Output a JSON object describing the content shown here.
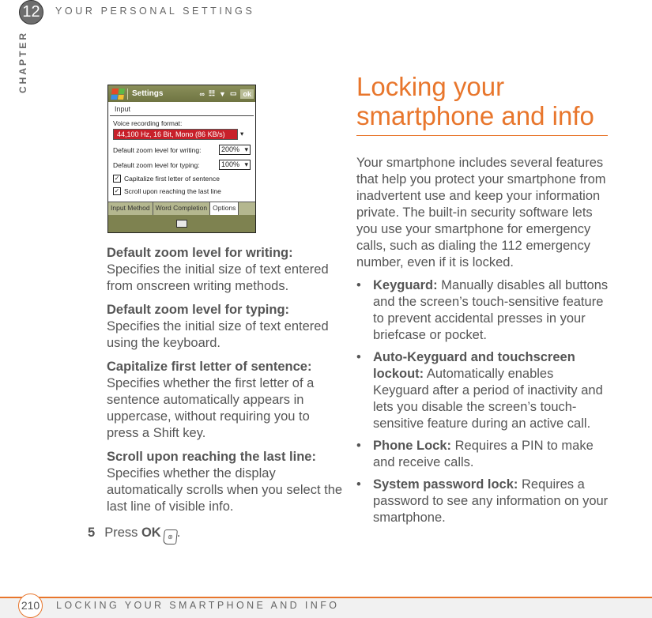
{
  "header": {
    "chapter_number": "12",
    "chapter_label": "CHAPTER",
    "section_title": "YOUR PERSONAL SETTINGS"
  },
  "phone_screen": {
    "app_title": "Settings",
    "ok_label": "ok",
    "status_icons": [
      "voicemail-icon",
      "connectivity-icon",
      "signal-icon",
      "battery-icon"
    ],
    "subtitle": "Input",
    "voice_format_label": "Voice recording format:",
    "voice_format_value": "44,100 Hz, 16 Bit, Mono (86 KB/s)",
    "zoom_writing_label": "Default zoom level for writing:",
    "zoom_writing_value": "200%",
    "zoom_typing_label": "Default zoom level for typing:",
    "zoom_typing_value": "100%",
    "checkboxes": [
      {
        "label": "Capitalize first letter of sentence",
        "checked": true
      },
      {
        "label": "Scroll upon reaching the last line",
        "checked": true
      }
    ],
    "tabs": [
      "Input Method",
      "Word Completion",
      "Options"
    ],
    "active_tab": "Options",
    "highlight_color": "#c8202a"
  },
  "left_column": {
    "items": [
      {
        "term": "Default zoom level for writing:",
        "desc": "Specifies the initial size of text entered from onscreen writing methods."
      },
      {
        "term": "Default zoom level for typing:",
        "desc": "Specifies the initial size of text entered using the keyboard."
      },
      {
        "term": "Capitalize first letter of sentence:",
        "desc": "Specifies whether the first letter of a sentence automatically appears in uppercase, without requiring you to press a Shift key."
      },
      {
        "term": "Scroll upon reaching the last line:",
        "desc": "Specifies whether the display automatically scrolls when you select the last line of visible info."
      }
    ],
    "step": {
      "number": "5",
      "text": "Press",
      "bold": "OK",
      "end": "."
    }
  },
  "right_column": {
    "title": "Locking your smartphone and info",
    "accent_color": "#e8762c",
    "intro": "Your smartphone includes several features that help you protect your smartphone from inadvertent use and keep your information private. The built-in security software lets you use your smartphone for emergency calls, such as dialing the 112 emergency number, even if it is locked.",
    "bullets": [
      {
        "term": "Keyguard:",
        "desc": "Manually disables all buttons and the screen’s touch-sensitive feature to prevent accidental presses in your briefcase or pocket."
      },
      {
        "term": "Auto-Keyguard and touchscreen lockout:",
        "desc": "Automatically enables Keyguard after a period of inactivity and lets you disable the screen’s touch-sensitive feature during an active call."
      },
      {
        "term": "Phone Lock:",
        "desc": "Requires a PIN to make and receive calls."
      },
      {
        "term": "System password lock:",
        "desc": "Requires a password to see any information on your smartphone."
      }
    ]
  },
  "footer": {
    "page_number": "210",
    "section_title": "LOCKING YOUR SMARTPHONE AND INFO"
  }
}
